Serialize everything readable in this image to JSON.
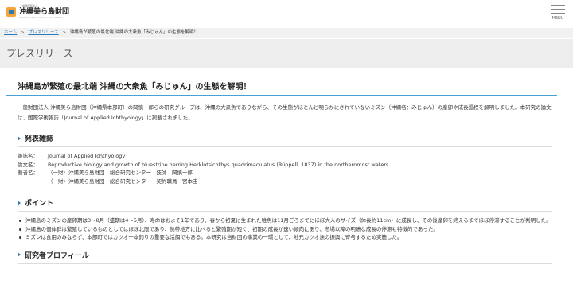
{
  "header": {
    "logo_small": "一般財団法人",
    "logo_main": "沖縄美ら島財団",
    "logo_en": "Okinawa Churashima Foundation",
    "menu_label": "MENU"
  },
  "breadcrumb": {
    "home": "ホーム",
    "separator": ">",
    "press": "プレスリリース",
    "current": "沖縄島が繁殖の最北端 沖縄の大衆魚「みじゅん」の生態を解明！"
  },
  "page_title": "プレスリリース",
  "article": {
    "title": "沖縄島が繁殖の最北端 沖縄の大衆魚「みじゅん」の生態を解明！",
    "intro": "一般財団法人 沖縄美ら島財団（沖縄県本部町）の岡慎一郎らの研究グループは、沖縄の大衆魚でありながら、その生態がほとんど明らかにされていないミズン（沖縄名：みじゅん）の産卵や成長過程を解明しました。本研究の論文は、国際学術雑誌「Journal of Applied Ichthyology」に掲載されました。"
  },
  "publication": {
    "heading": "発表雑誌",
    "rows": [
      {
        "label": "雑誌名：",
        "value": "Journal of Applied Ichthyology"
      },
      {
        "label": "論文名：",
        "value": "Reproductive biology and growth of bluestripe herring Herklotsichthys quadrimaculatus (Rüppell, 1837) in the northernmost waters"
      },
      {
        "label": "著者名：",
        "value": "（一財）沖縄美ら島財団　総合研究センター　技師　岡慎一郎"
      },
      {
        "label": "",
        "value": "（一財）沖縄美ら島財団　総合研究センター　契約職員　宮本圭"
      }
    ]
  },
  "points": {
    "heading": "ポイント",
    "items": [
      "沖縄島のミズンの産卵期は3～8月（盛期は4～5月）、寿命はおよそ1年であり、春から初夏に生まれた稚魚は11月ごろまでにほぼ大人のサイズ（体長約11cm）に成長し、その後産卵を終えるまでほぼ停滞することが判明した。",
      "沖縄島の個体群は繁殖しているものとしてはほぼ北限であり、熱帯地方に比べると繁殖期が短く、初期の成長が速い傾向にあり、冬場以降の明瞭な成長の停滞も特徴的であった。",
      "ミズンは食用のみならず、本部町ではカツオ一本釣りの重要な活餌でもある。本研究は当財団の事業の一環として、地元カツオ漁の振興に寄与するため実施した。"
    ]
  },
  "profile": {
    "heading": "研究者プロフィール"
  },
  "colors": {
    "accent": "#45a2d6",
    "link": "#2b79b8",
    "logo_orange": "#f3a53a"
  }
}
